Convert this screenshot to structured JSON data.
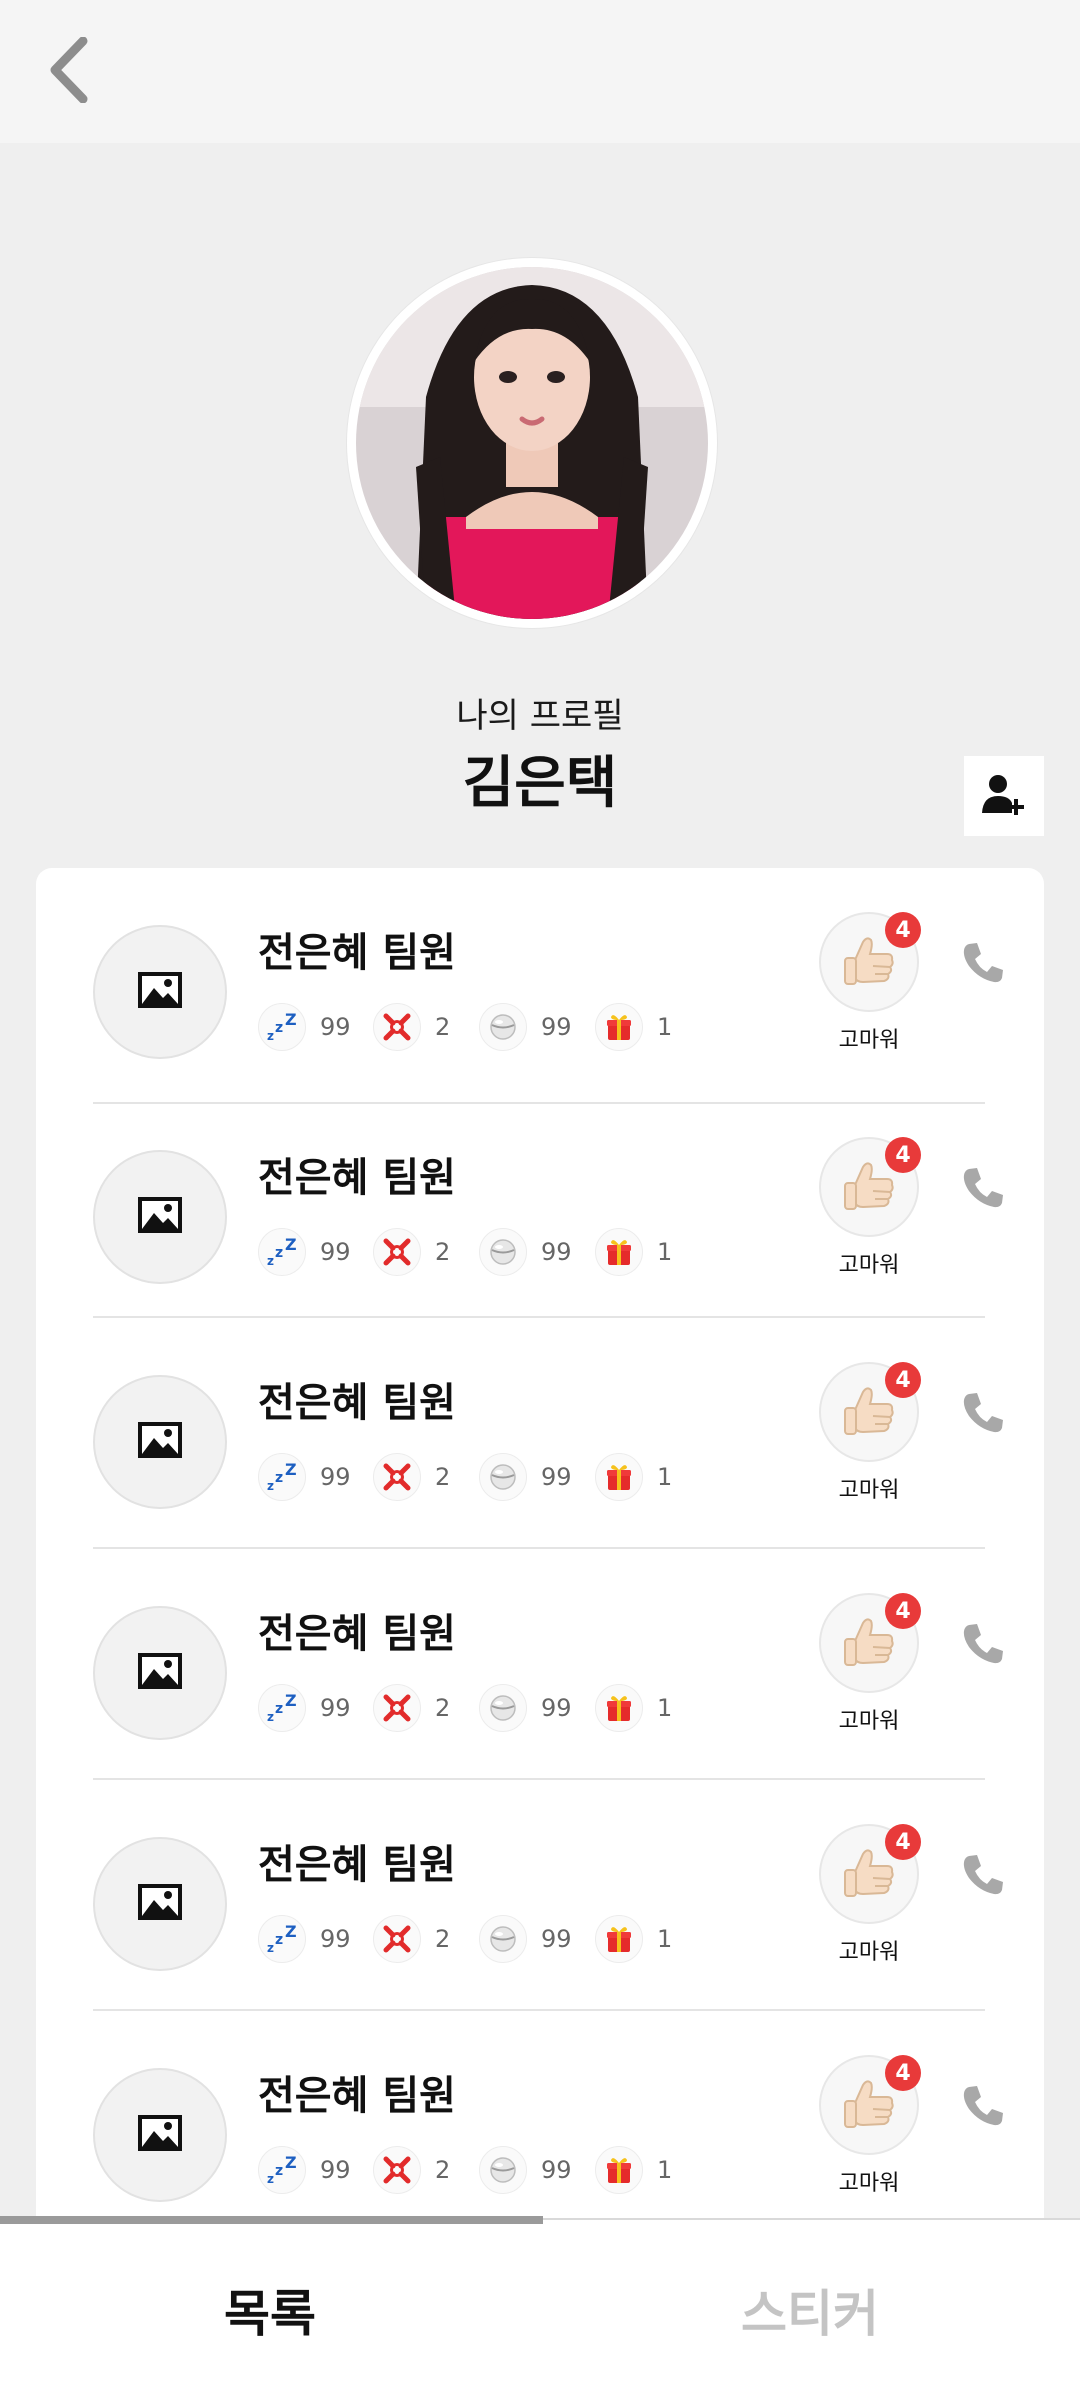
{
  "header": {
    "back_icon": "chevron-left-icon"
  },
  "profile": {
    "caption": "나의 프로필",
    "name": "김은택",
    "add_friend_icon": "person-add-icon"
  },
  "members": [
    {
      "name": "전은혜 팀원",
      "stats": {
        "sleep": "99",
        "angry": "2",
        "ball": "99",
        "gift": "1"
      },
      "thanks_count": "4",
      "thanks_label": "고마워"
    },
    {
      "name": "전은혜 팀원",
      "stats": {
        "sleep": "99",
        "angry": "2",
        "ball": "99",
        "gift": "1"
      },
      "thanks_count": "4",
      "thanks_label": "고마워"
    },
    {
      "name": "전은혜 팀원",
      "stats": {
        "sleep": "99",
        "angry": "2",
        "ball": "99",
        "gift": "1"
      },
      "thanks_count": "4",
      "thanks_label": "고마워"
    },
    {
      "name": "전은혜 팀원",
      "stats": {
        "sleep": "99",
        "angry": "2",
        "ball": "99",
        "gift": "1"
      },
      "thanks_count": "4",
      "thanks_label": "고마워"
    },
    {
      "name": "전은혜 팀원",
      "stats": {
        "sleep": "99",
        "angry": "2",
        "ball": "99",
        "gift": "1"
      },
      "thanks_count": "4",
      "thanks_label": "고마워"
    },
    {
      "name": "전은혜 팀원",
      "stats": {
        "sleep": "99",
        "angry": "2",
        "ball": "99",
        "gift": "1"
      },
      "thanks_count": "4",
      "thanks_label": "고마워"
    }
  ],
  "tabs": [
    {
      "label": "목록",
      "active": true
    },
    {
      "label": "스티커",
      "active": false
    }
  ],
  "colors": {
    "badge": "#e83a3a",
    "accent_pink": "#e3175a"
  }
}
